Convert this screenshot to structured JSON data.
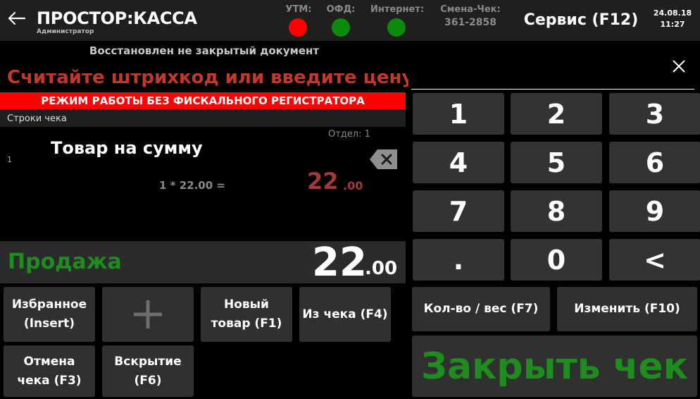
{
  "header": {
    "title": "ПРОСТОР:КАССА",
    "user_role": "Администратор",
    "status": [
      {
        "label": "УТМ:",
        "color": "#ff0000"
      },
      {
        "label": "ОФД:",
        "color": "#0b8a0b"
      },
      {
        "label": "Интернет:",
        "color": "#0b8a0b"
      }
    ],
    "shift_label": "Смена-Чек:",
    "shift_value": "361-2858",
    "service_label": "Сервис (F12)",
    "date": "24.08.18",
    "time": "11:27"
  },
  "receipt": {
    "restored_message": "Восстановлен не закрытый документ",
    "scan_prompt": "Считайте штрихкод или введите цену",
    "mode_banner": "РЕЖИМ РАБОТЫ БЕЗ ФИСКАЛЬНОГО РЕГИСТРАТОРА",
    "lines_header": "Строки чека",
    "lines": [
      {
        "index": "1",
        "department": "Отдел: 1",
        "name": "Товар на сумму",
        "calc": "1 * 22.00 =",
        "sum_int": "22",
        "sum_dec": ".00"
      }
    ],
    "operation": "Продажа",
    "total_int": "22",
    "total_dec": ".00"
  },
  "function_buttons": {
    "favorites": "Избранное\n(Insert)",
    "new_item": "Новый\nтовар (F1)",
    "from_receipt": "Из чека (F4)",
    "cancel": "Отмена\nчека (F3)",
    "open": "Вскрытие\n(F6)"
  },
  "keypad": {
    "keys": [
      "1",
      "2",
      "3",
      "4",
      "5",
      "6",
      "7",
      "8",
      "9",
      ".",
      "0",
      "<"
    ],
    "qty_weight": "Кол-во / вес (F7)",
    "change": "Изменить (F10)",
    "close_receipt": "Закрыть чек"
  },
  "colors": {
    "accent_red": "#c0392b",
    "banner_red": "#ff0000",
    "green": "#1e8c1e",
    "sum_red": "#a23a3a"
  }
}
